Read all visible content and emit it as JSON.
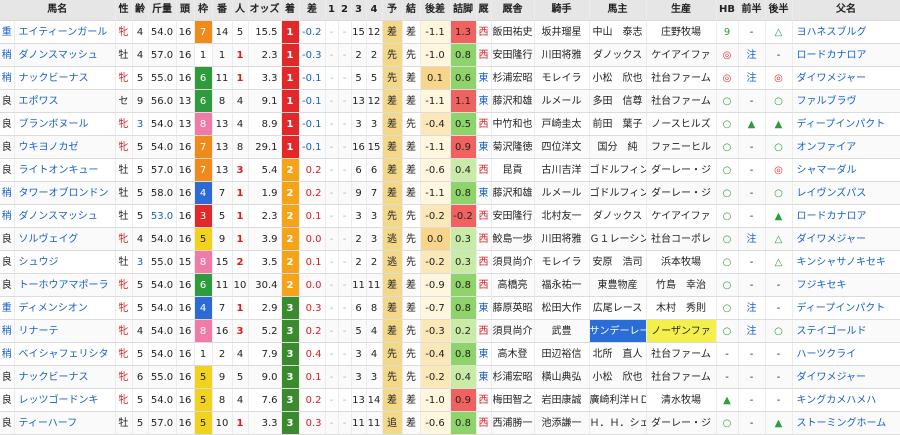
{
  "headers": [
    "馬名",
    "性",
    "齢",
    "斤量",
    "頭",
    "枠",
    "番",
    "人",
    "オッズ",
    "着",
    "差",
    "1",
    "2",
    "3",
    "4",
    "予",
    "結",
    "後差",
    "詰脚",
    "厩",
    "厩舎",
    "騎手",
    "馬主",
    "生産",
    "HB",
    "前半",
    "後半",
    "父名"
  ],
  "rows": [
    {
      "baba": "重",
      "name": "エイティーンガール",
      "sex": "牝",
      "age": "4",
      "kin": "54.0",
      "to": "16",
      "waku": "7",
      "ban": "14",
      "nin": "5",
      "odds": "15.5",
      "chaku": "1",
      "sa": "-0.2",
      "c1": "-",
      "c2": "-",
      "c3": "15",
      "c4": "12",
      "yo": "差",
      "ke": "差",
      "kosa": "-1.1",
      "tsume": "1.3",
      "kyu": "西",
      "kyusha": "飯田祐史",
      "kishu": "坂井瑠星",
      "banushi": "中山　泰志",
      "seisan": "庄野牧場",
      "hb": "9",
      "zen": "-",
      "kou": "△",
      "chichi": "ヨハネスブルグ"
    },
    {
      "baba": "稍",
      "name": "ダノンスマッシュ",
      "sex": "牡",
      "age": "4",
      "kin": "57.0",
      "to": "16",
      "waku": "1",
      "ban": "1",
      "nin": "1",
      "odds": "2.3",
      "chaku": "1",
      "sa": "-0.3",
      "c1": "-",
      "c2": "-",
      "c3": "2",
      "c4": "2",
      "yo": "先",
      "ke": "先",
      "kosa": "-1.0",
      "tsume": "0.8",
      "kyu": "西",
      "kyusha": "安田隆行",
      "kishu": "川田将雅",
      "banushi": "ダノックス",
      "seisan": "ケイアイファ",
      "hb": "◎",
      "zen": "注",
      "kou": "-",
      "chichi": "ロードカナロア"
    },
    {
      "baba": "稍",
      "name": "ナックビーナス",
      "sex": "牝",
      "age": "5",
      "kin": "55.0",
      "to": "16",
      "waku": "6",
      "ban": "11",
      "nin": "1",
      "odds": "3.3",
      "chaku": "1",
      "sa": "-0.1",
      "c1": "-",
      "c2": "-",
      "c3": "5",
      "c4": "5",
      "yo": "先",
      "ke": "差",
      "kosa": "0.1",
      "tsume": "0.6",
      "kyu": "東",
      "kyusha": "杉浦宏昭",
      "kishu": "モレイラ",
      "banushi": "小松　欣也",
      "seisan": "社台ファーム",
      "hb": "◎",
      "zen": "注",
      "kou": "◎",
      "chichi": "ダイワメジャー"
    },
    {
      "baba": "良",
      "name": "エポワス",
      "sex": "セ",
      "age": "9",
      "kin": "56.0",
      "to": "13",
      "waku": "6",
      "ban": "8",
      "nin": "4",
      "odds": "9.1",
      "chaku": "1",
      "sa": "-0.1",
      "c1": "-",
      "c2": "-",
      "c3": "13",
      "c4": "12",
      "yo": "差",
      "ke": "差",
      "kosa": "-1.1",
      "tsume": "1.1",
      "kyu": "東",
      "kyusha": "藤沢和雄",
      "kishu": "ルメール",
      "banushi": "多田　信尊",
      "seisan": "社台ファーム",
      "hb": "○",
      "zen": "-",
      "kou": "○",
      "chichi": "ファルブラヴ"
    },
    {
      "baba": "良",
      "name": "ブランボヌール",
      "sex": "牝",
      "age": "3",
      "kin": "54.0",
      "to": "13",
      "waku": "8",
      "ban": "13",
      "nin": "4",
      "odds": "8.9",
      "chaku": "1",
      "sa": "-0.1",
      "c1": "-",
      "c2": "-",
      "c3": "3",
      "c4": "3",
      "yo": "差",
      "ke": "先",
      "kosa": "-0.4",
      "tsume": "0.5",
      "kyu": "西",
      "kyusha": "中竹和也",
      "kishu": "戸崎圭太",
      "banushi": "前田　葉子",
      "seisan": "ノースヒルズ",
      "hb": "○",
      "zen": "▲",
      "kou": "▲",
      "chichi": "ディープインパクト"
    },
    {
      "baba": "良",
      "name": "ウキヨノカゼ",
      "sex": "牝",
      "age": "5",
      "kin": "54.0",
      "to": "16",
      "waku": "7",
      "ban": "13",
      "nin": "8",
      "odds": "29.1",
      "chaku": "1",
      "sa": "-0.1",
      "c1": "-",
      "c2": "-",
      "c3": "16",
      "c4": "15",
      "yo": "差",
      "ke": "差",
      "kosa": "-1.1",
      "tsume": "0.9",
      "kyu": "東",
      "kyusha": "菊沢隆徳",
      "kishu": "四位洋文",
      "banushi": "国分　純",
      "seisan": "ファニーヒル",
      "hb": "○",
      "zen": "-",
      "kou": "○",
      "chichi": "オンファイア"
    },
    {
      "baba": "良",
      "name": "ライトオンキュー",
      "sex": "牡",
      "age": "5",
      "kin": "57.0",
      "to": "16",
      "waku": "7",
      "ban": "13",
      "nin": "3",
      "odds": "5.4",
      "chaku": "2",
      "sa": "0.2",
      "c1": "-",
      "c2": "-",
      "c3": "6",
      "c4": "6",
      "yo": "差",
      "ke": "差",
      "kosa": "-0.6",
      "tsume": "0.4",
      "kyu": "西",
      "kyusha": "昆貢",
      "kishu": "古川吉洋",
      "banushi": "ゴドルフィン",
      "seisan": "ダーレー・ジ",
      "hb": "○",
      "zen": "-",
      "kou": "◎",
      "chichi": "シャマーダル"
    },
    {
      "baba": "稍",
      "name": "タワーオブロンドン",
      "sex": "牡",
      "age": "5",
      "kin": "58.0",
      "to": "16",
      "waku": "4",
      "ban": "7",
      "nin": "1",
      "odds": "1.9",
      "chaku": "2",
      "sa": "0.2",
      "c1": "-",
      "c2": "-",
      "c3": "9",
      "c4": "7",
      "yo": "差",
      "ke": "差",
      "kosa": "-1.1",
      "tsume": "0.8",
      "kyu": "東",
      "kyusha": "藤沢和雄",
      "kishu": "ルメール",
      "banushi": "ゴドルフィン",
      "seisan": "ダーレー・ジ",
      "hb": "○",
      "zen": "-",
      "kou": "○",
      "chichi": "レイヴンズパス"
    },
    {
      "baba": "稍",
      "name": "ダノンスマッシュ",
      "sex": "牡",
      "age": "5",
      "kin": "53.0",
      "to": "16",
      "waku": "3",
      "ban": "5",
      "nin": "1",
      "odds": "2.3",
      "chaku": "2",
      "sa": "0.1",
      "c1": "-",
      "c2": "-",
      "c3": "3",
      "c4": "3",
      "yo": "先",
      "ke": "先",
      "kosa": "-0.2",
      "tsume": "-0.2",
      "kyu": "西",
      "kyusha": "安田隆行",
      "kishu": "北村友一",
      "banushi": "ダノックス",
      "seisan": "ケイアイファ",
      "hb": "○",
      "zen": "-",
      "kou": "▲",
      "chichi": "ロードカナロア"
    },
    {
      "baba": "良",
      "name": "ソルヴェイグ",
      "sex": "牝",
      "age": "4",
      "kin": "54.0",
      "to": "16",
      "waku": "5",
      "ban": "9",
      "nin": "1",
      "odds": "3.9",
      "chaku": "2",
      "sa": "0.0",
      "c1": "-",
      "c2": "-",
      "c3": "2",
      "c4": "3",
      "yo": "逃",
      "ke": "先",
      "kosa": "0.0",
      "tsume": "0.3",
      "kyu": "西",
      "kyusha": "鮫島一歩",
      "kishu": "川田将雅",
      "banushi": "Ｇ１レーシン",
      "seisan": "社台コーポレ",
      "hb": "○",
      "zen": "注",
      "kou": "△",
      "chichi": "ダイワメジャー"
    },
    {
      "baba": "良",
      "name": "シュウジ",
      "sex": "牡",
      "age": "3",
      "kin": "55.0",
      "to": "15",
      "waku": "8",
      "ban": "15",
      "nin": "2",
      "odds": "3.5",
      "chaku": "2",
      "sa": "0.1",
      "c1": "-",
      "c2": "-",
      "c3": "2",
      "c4": "2",
      "yo": "逃",
      "ke": "先",
      "kosa": "-0.2",
      "tsume": "0.3",
      "kyu": "西",
      "kyusha": "須貝尚介",
      "kishu": "モレイラ",
      "banushi": "安原　浩司",
      "seisan": "浜本牧場",
      "hb": "○",
      "zen": "-",
      "kou": "△",
      "chichi": "キンシャサノキセキ"
    },
    {
      "baba": "良",
      "name": "トーホウアマポーラ",
      "sex": "牝",
      "age": "5",
      "kin": "54.0",
      "to": "16",
      "waku": "6",
      "ban": "11",
      "nin": "10",
      "odds": "30.4",
      "chaku": "2",
      "sa": "0.0",
      "c1": "-",
      "c2": "-",
      "c3": "11",
      "c4": "11",
      "yo": "差",
      "ke": "差",
      "kosa": "-0.9",
      "tsume": "0.8",
      "kyu": "西",
      "kyusha": "高橋亮",
      "kishu": "福永祐一",
      "banushi": "東豊物産",
      "seisan": "竹島　幸治",
      "hb": "○",
      "zen": "-",
      "kou": "-",
      "chichi": "フジキセキ"
    },
    {
      "baba": "重",
      "name": "ディメンシオン",
      "sex": "牝",
      "age": "5",
      "kin": "54.0",
      "to": "16",
      "waku": "4",
      "ban": "7",
      "nin": "1",
      "odds": "2.9",
      "chaku": "3",
      "sa": "0.3",
      "c1": "-",
      "c2": "-",
      "c3": "6",
      "c4": "8",
      "yo": "差",
      "ke": "差",
      "kosa": "-0.7",
      "tsume": "0.8",
      "kyu": "東",
      "kyusha": "藤原英昭",
      "kishu": "松田大作",
      "banushi": "広尾レース",
      "seisan": "木村　秀則",
      "hb": "○",
      "zen": "注",
      "kou": "-",
      "chichi": "ディープインパクト"
    },
    {
      "baba": "稍",
      "name": "リナーテ",
      "sex": "牝",
      "age": "4",
      "kin": "54.0",
      "to": "16",
      "waku": "8",
      "ban": "16",
      "nin": "3",
      "odds": "5.2",
      "chaku": "3",
      "sa": "0.2",
      "c1": "-",
      "c2": "-",
      "c3": "5",
      "c4": "4",
      "yo": "差",
      "ke": "先",
      "kosa": "-0.3",
      "tsume": "0.2",
      "kyu": "西",
      "kyusha": "須貝尚介",
      "kishu": "武豊",
      "banushi": "サンデーレー",
      "seisan": "ノーザンファ",
      "hb": "○",
      "zen": "注",
      "kou": "○",
      "chichi": "ステイゴールド"
    },
    {
      "baba": "稍",
      "name": "ベイシャフェリシタ",
      "sex": "牝",
      "age": "5",
      "kin": "54.0",
      "to": "16",
      "waku": "1",
      "ban": "2",
      "nin": "4",
      "odds": "7.9",
      "chaku": "3",
      "sa": "0.4",
      "c1": "-",
      "c2": "-",
      "c3": "3",
      "c4": "4",
      "yo": "先",
      "ke": "先",
      "kosa": "-0.4",
      "tsume": "0.8",
      "kyu": "東",
      "kyusha": "高木登",
      "kishu": "田辺裕信",
      "banushi": "北所　直人",
      "seisan": "社台ファーム",
      "hb": "-",
      "zen": "-",
      "kou": "-",
      "chichi": "ハーツクライ"
    },
    {
      "baba": "良",
      "name": "ナックビーナス",
      "sex": "牝",
      "age": "6",
      "kin": "55.0",
      "to": "16",
      "waku": "5",
      "ban": "9",
      "nin": "5",
      "odds": "9.0",
      "chaku": "3",
      "sa": "0.1",
      "c1": "-",
      "c2": "-",
      "c3": "3",
      "c4": "3",
      "yo": "先",
      "ke": "先",
      "kosa": "-0.2",
      "tsume": "0.4",
      "kyu": "東",
      "kyusha": "杉浦宏昭",
      "kishu": "横山典弘",
      "banushi": "小松　欣也",
      "seisan": "社台ファーム",
      "hb": "-",
      "zen": "-",
      "kou": "-",
      "chichi": "ダイワメジャー"
    },
    {
      "baba": "良",
      "name": "レッツゴードンキ",
      "sex": "牝",
      "age": "5",
      "kin": "54.0",
      "to": "16",
      "waku": "5",
      "ban": "8",
      "nin": "4",
      "odds": "7.6",
      "chaku": "3",
      "sa": "0.2",
      "c1": "-",
      "c2": "-",
      "c3": "13",
      "c4": "14",
      "yo": "差",
      "ke": "差",
      "kosa": "-1.0",
      "tsume": "0.9",
      "kyu": "西",
      "kyusha": "梅田智之",
      "kishu": "岩田康誠",
      "banushi": "廣崎利洋ＨＤ",
      "seisan": "清水牧場",
      "hb": "▲",
      "zen": "-",
      "kou": "-",
      "chichi": "キングカメハメハ"
    },
    {
      "baba": "良",
      "name": "ティーハーフ",
      "sex": "牡",
      "age": "5",
      "kin": "57.0",
      "to": "16",
      "waku": "5",
      "ban": "10",
      "nin": "1",
      "odds": "3.3",
      "chaku": "3",
      "sa": "0.3",
      "c1": "-",
      "c2": "-",
      "c3": "11",
      "c4": "11",
      "yo": "追",
      "ke": "差",
      "kosa": "-0.6",
      "tsume": "0.8",
      "kyu": "西",
      "kyusha": "西浦勝一",
      "kishu": "池添謙一",
      "banushi": "Ｈ．Ｈ．シェ",
      "seisan": "ダーレー・ジ",
      "hb": "○",
      "zen": "-",
      "kou": "▲",
      "chichi": "ストーミングホーム"
    }
  ]
}
